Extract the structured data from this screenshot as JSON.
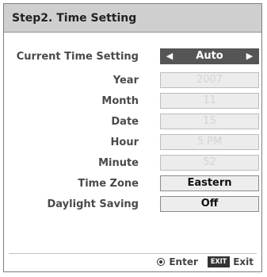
{
  "title": "Step2. Time Setting",
  "settings": [
    {
      "label": "Current Time Setting",
      "value": "Auto",
      "state": "selected"
    },
    {
      "label": "Year",
      "value": "2007",
      "state": "disabled"
    },
    {
      "label": "Month",
      "value": "11",
      "state": "disabled"
    },
    {
      "label": "Date",
      "value": "15",
      "state": "disabled"
    },
    {
      "label": "Hour",
      "value": "5 PM",
      "state": "disabled"
    },
    {
      "label": "Minute",
      "value": "52",
      "state": "disabled"
    },
    {
      "label": "Time Zone",
      "value": "Eastern",
      "state": "active"
    },
    {
      "label": "Daylight Saving",
      "value": "Off",
      "state": "active"
    }
  ],
  "footer": {
    "enter_label": "Enter",
    "exit_key": "EXIT",
    "exit_label": "Exit"
  }
}
